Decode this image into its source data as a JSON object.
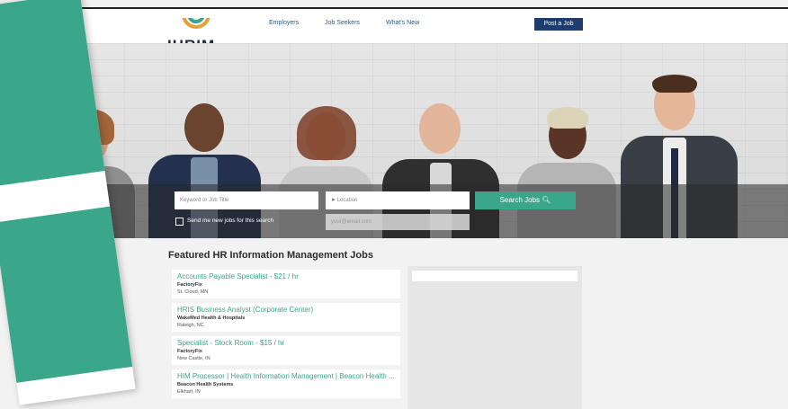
{
  "header": {
    "logo_text": "IHRIM",
    "nav": [
      "Employers",
      "Job Seekers",
      "What's New"
    ],
    "post_job_label": "Post a Job"
  },
  "search": {
    "keyword_placeholder": "Keyword or Job Title",
    "location_placeholder": "Location",
    "search_button": "Search Jobs",
    "send_label": "Send me new jobs for this search",
    "email_placeholder": "your@email.com"
  },
  "featured": {
    "title": "Featured HR Information Management Jobs",
    "jobs": [
      {
        "title": "Accounts Payable Specialist - $21 / hr",
        "company": "FactoryFix",
        "location": "St. Cloud, MN"
      },
      {
        "title": "HRIS Business Analyst (Corporate Center)",
        "company": "WakeMed Health & Hospitals",
        "location": "Raleigh, NC"
      },
      {
        "title": "Specialist - Stock Room - $15 / hr",
        "company": "FactoryFix",
        "location": "New Castle, IN"
      },
      {
        "title": "HIM Processor | Health Information Management | Beacon Health ...",
        "company": "Beacon Health Systems",
        "location": "Elkhart, IN"
      }
    ]
  },
  "colors": {
    "accent": "#3aa68a",
    "nav_dark": "#1c3d6e",
    "logo_orange": "#e8a13a"
  },
  "icons": {
    "search": "search-icon",
    "location": "location-arrow-icon"
  }
}
